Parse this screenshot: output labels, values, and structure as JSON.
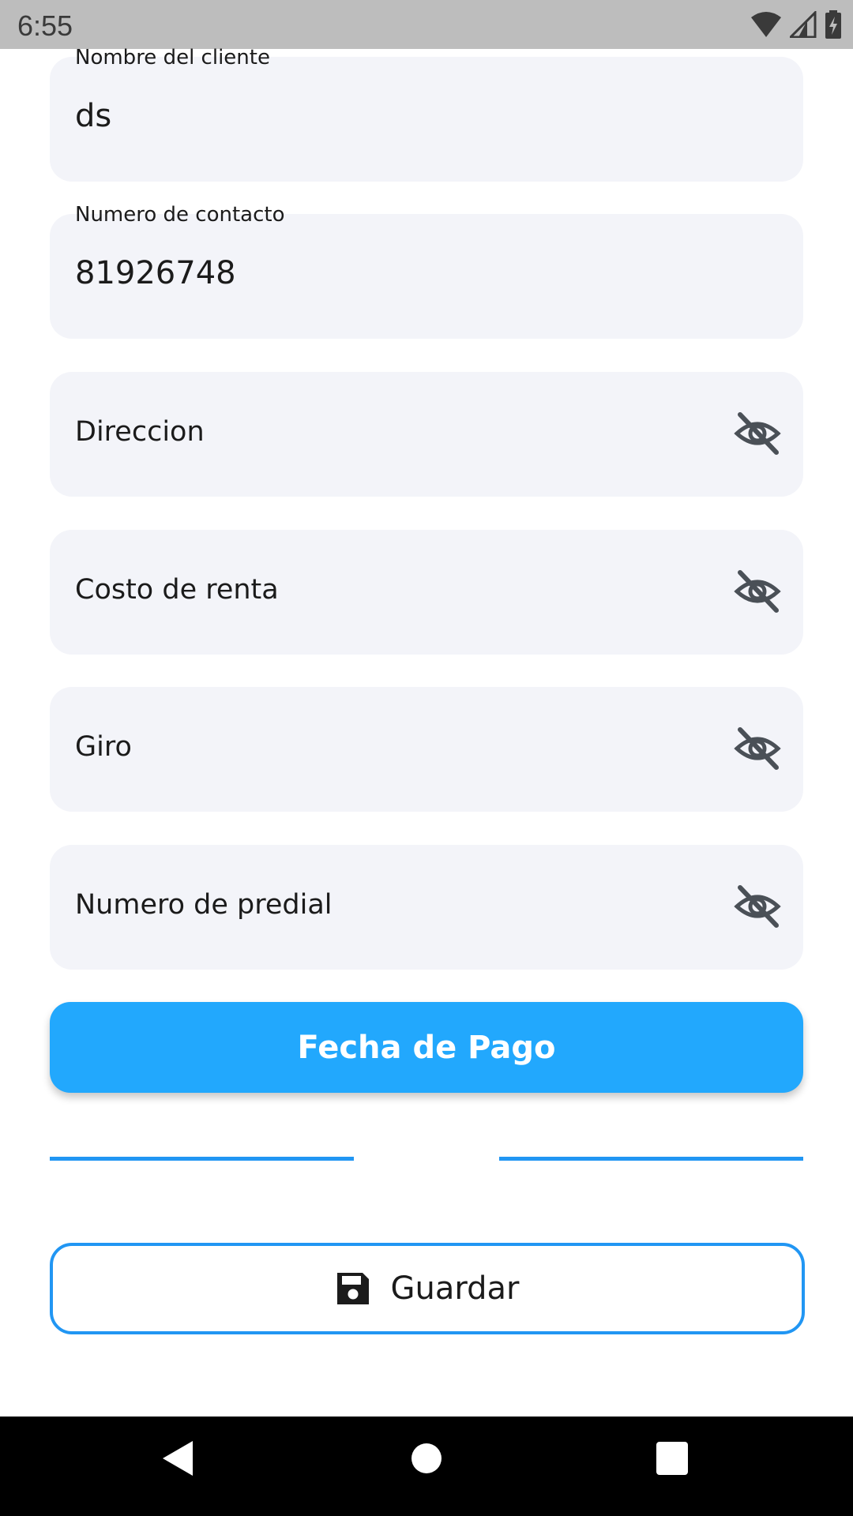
{
  "status_bar": {
    "time": "6:55"
  },
  "form": {
    "fields": [
      {
        "label": "Nombre del cliente",
        "value": "ds"
      },
      {
        "label": "Numero de contacto",
        "value": "81926748"
      },
      {
        "placeholder": "Direccion",
        "icon": "eye-off-icon"
      },
      {
        "placeholder": "Costo de renta",
        "icon": "eye-off-icon"
      },
      {
        "placeholder": "Giro",
        "icon": "eye-off-icon"
      },
      {
        "placeholder": "Numero de predial",
        "icon": "eye-off-icon"
      }
    ],
    "fecha_button_label": "Fecha de Pago",
    "guardar_button_label": "Guardar",
    "guardar_icon": "save-icon"
  },
  "colors": {
    "status_bar": "#bdbdbd",
    "field_background": "#f3f4f9",
    "primary_button": "#22a8fd",
    "accent": "#2196f3",
    "nav_bar": "#000000"
  }
}
